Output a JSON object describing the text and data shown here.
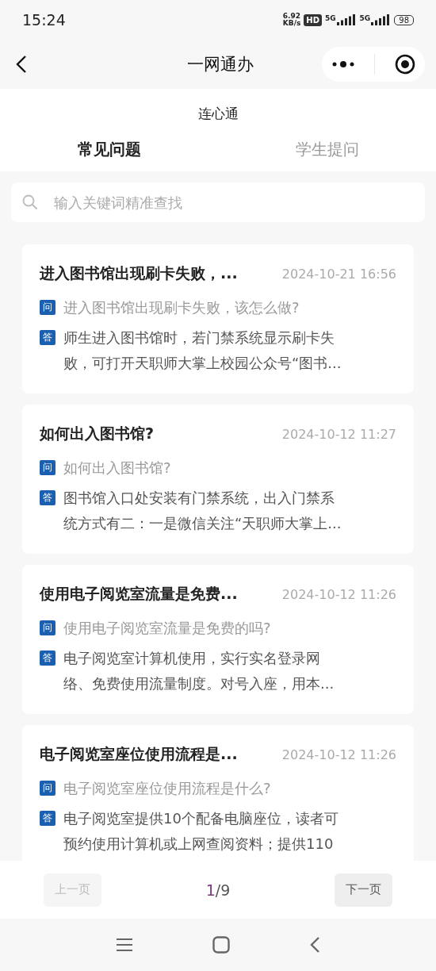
{
  "status_bar": {
    "time": "15:24",
    "net_speed_value": "6.92",
    "net_speed_unit": "KB/s",
    "hd_badge": "HD",
    "sim_1": "5G",
    "sim_2": "5G",
    "battery": "98"
  },
  "nav_bar": {
    "title": "一网通办"
  },
  "subtitle": "连心通",
  "tabs": [
    {
      "label": "常见问题",
      "selected": true
    },
    {
      "label": "学生提问",
      "selected": false
    }
  ],
  "search": {
    "placeholder": "输入关键词精准查找"
  },
  "faq_items": [
    {
      "title": "进入图书馆出现刷卡失败，...",
      "date": "2024-10-21 16:56",
      "question_tag": "问",
      "question": "进入图书馆出现刷卡失败，该怎么做?",
      "answer_tag": "答",
      "answer": [
        "师生进入图书馆时，若门禁系统显示刷卡失",
        "败，可打开天职师大掌上校园公众号“图书..."
      ]
    },
    {
      "title": "如何出入图书馆?",
      "date": "2024-10-12 11:27",
      "question_tag": "问",
      "question": "如何出入图书馆?",
      "answer_tag": "答",
      "answer": [
        "图书馆入口处安装有门禁系统，出入门禁系",
        "统方式有二：一是微信关注“天职师大掌上..."
      ]
    },
    {
      "title": "使用电子阅览室流量是免费...",
      "date": "2024-10-12 11:26",
      "question_tag": "问",
      "question": "使用电子阅览室流量是免费的吗?",
      "answer_tag": "答",
      "answer": [
        "电子阅览室计算机使用，实行实名登录网",
        "络、免费使用流量制度。对号入座，用本..."
      ]
    },
    {
      "title": "电子阅览室座位使用流程是...",
      "date": "2024-10-12 11:26",
      "question_tag": "问",
      "question": "电子阅览室座位使用流程是什么?",
      "answer_tag": "答",
      "answer": [
        "电子阅览室提供10个配备电脑座位，读者可",
        "预约使用计算机或上网查阅资料；提供110"
      ]
    }
  ],
  "pager": {
    "prev": {
      "label": "上一页",
      "disabled": true
    },
    "current": "1",
    "separator": "/",
    "total": "9",
    "next": {
      "label": "下一页",
      "disabled": false
    }
  }
}
